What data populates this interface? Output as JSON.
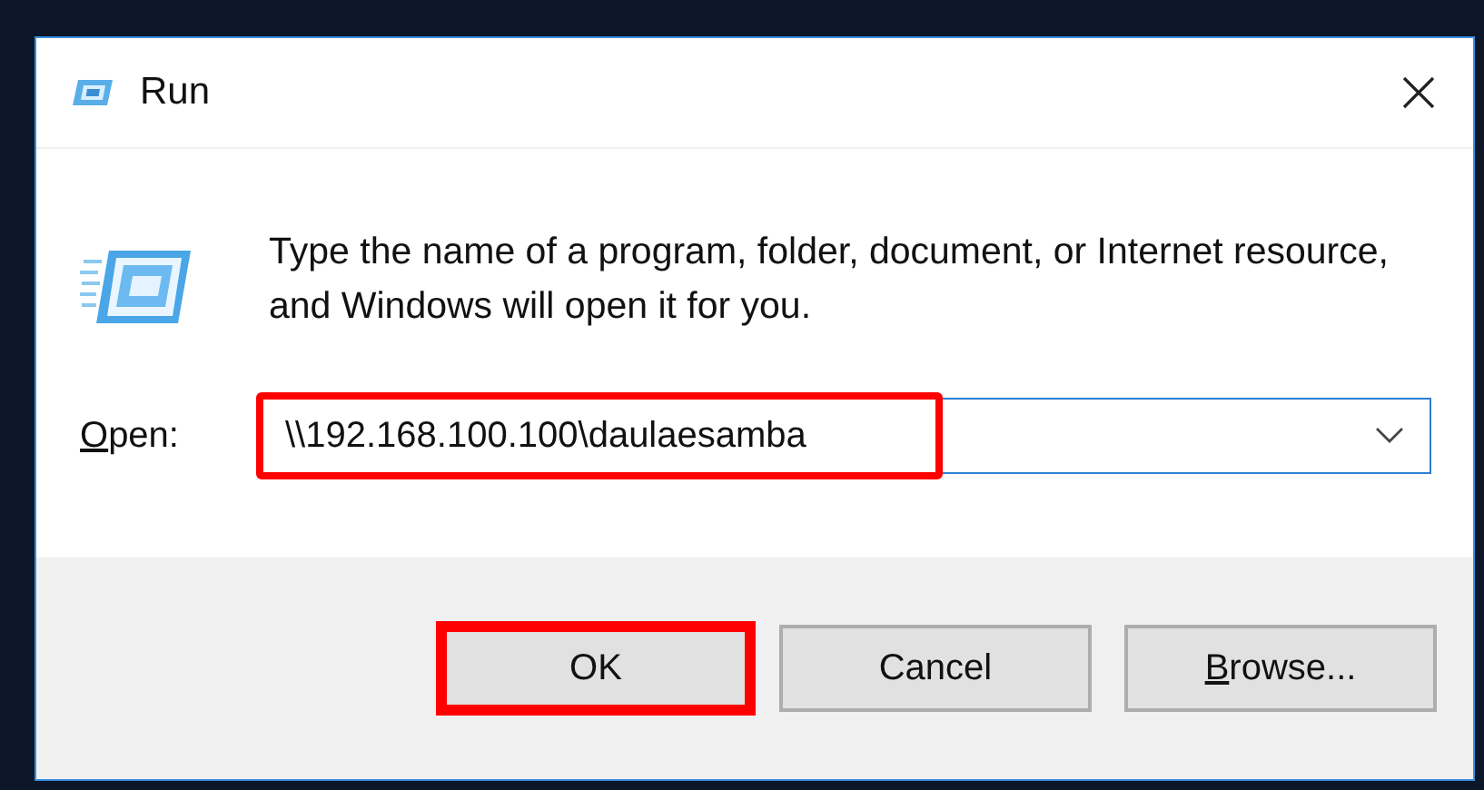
{
  "window": {
    "title": "Run"
  },
  "description": "Type the name of a program, folder, document, or Internet resource, and Windows will open it for you.",
  "open_field": {
    "label": {
      "mnemonic": "O",
      "rest": "pen:"
    },
    "value": "\\\\192.168.100.100\\daulaesamba",
    "highlighted": true
  },
  "buttons": [
    {
      "kind": "ok",
      "label": {
        "rest": "OK"
      },
      "default": true,
      "highlighted": true
    },
    {
      "kind": "cancel",
      "label": {
        "rest": "Cancel"
      },
      "default": false,
      "highlighted": false
    },
    {
      "kind": "browse",
      "label": {
        "mnemonic": "B",
        "rest": "rowse..."
      },
      "default": false,
      "highlighted": false
    }
  ]
}
